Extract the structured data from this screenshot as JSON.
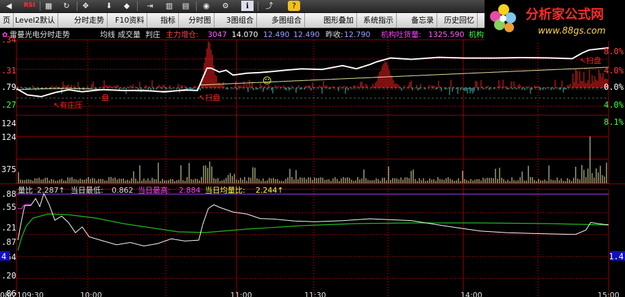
{
  "toolbar": {
    "icons": [
      "back-arrow-icon",
      "rsi-icon",
      "grid-icon",
      "refresh-icon",
      "move-icon",
      "arrow-down-icon",
      "diamond-icon",
      "level-icon",
      "stats-icon",
      "gallery-icon",
      "gauge-icon",
      "settings-icon",
      "info-icon",
      "chart-trend-icon",
      "help-icon"
    ],
    "rsi_label": "RSI"
  },
  "menu": {
    "items": [
      "页",
      "Level2默认",
      "分时走势",
      "F10资料",
      "指标",
      "分时图",
      "3图组合",
      "多图组合",
      "图形叠加",
      "系统指示",
      "备忘录",
      "历史回忆"
    ]
  },
  "logo": {
    "title": "分析家公式网",
    "url": "www.88gs.com"
  },
  "header": {
    "stock": "雷曼光电分时走势",
    "items": [
      "均线",
      "成交量",
      "判庄"
    ],
    "main_inflow_label": "主力增仓:",
    "main_inflow_value": "3047",
    "price": "14.070",
    "v2": "12.490",
    "v3": "12.490",
    "prev_close_label": "昨收:",
    "prev_close_value": "12.790",
    "inst_label": "机构吐货量:",
    "inst_value": "1325.590",
    "inst2_label": "机构"
  },
  "price_panel": {
    "left_labels": [
      ".34",
      ".31",
      ".79",
      ".27"
    ],
    "right_labels": [
      "8.0%",
      "4.0%",
      "0.0%",
      "4.0%",
      "8.1%"
    ],
    "annotations": [
      "↖扫盘",
      "↖扫盘",
      "↖有庄压",
      "盘"
    ]
  },
  "volume_panel": {
    "left_labels": [
      "124",
      "124",
      "375"
    ]
  },
  "ratio_panel": {
    "header_label": "量比",
    "ratio_value": "2.287↑",
    "low_label": "当日最低:",
    "low_value": "0.862",
    "high_label": "当日最高:",
    "high_value": "2.884",
    "avg_label": "当日均量比:",
    "avg_value": "2.244↑",
    "left_labels": [
      ".88",
      ".55",
      ".21",
      ".87",
      ".54",
      ".20",
      ".86"
    ],
    "right_labels": [
      "1.4"
    ],
    "left_marker": "4"
  },
  "time_axis": {
    "labels": [
      "08/21",
      "09:30",
      "10:00",
      "11:00",
      "11:30",
      "14:00",
      "15:00"
    ]
  },
  "colors": {
    "background": "#000000",
    "grid": "#a00000",
    "price_line": "#ffffff",
    "avg_line": "#e8e8a0",
    "up": "#ff2020",
    "down": "#40c0c0",
    "magenta": "#ff40ff",
    "yellow": "#ffff40",
    "ratio_avg": "#20c020"
  }
}
